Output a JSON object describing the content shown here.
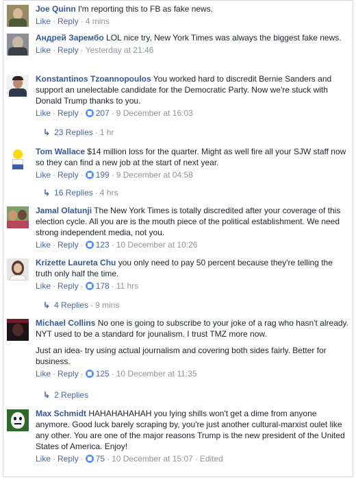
{
  "comments": [
    {
      "author": "Joe Quinn",
      "text": "I'm reporting this to FB as fake news.",
      "like": "Like",
      "reply": "Reply",
      "time": "4 mins"
    },
    {
      "author": "Андрей Зарембо",
      "text": "LOL nice try, New York Times was always the biggest fake news.",
      "like": "Like",
      "reply": "Reply",
      "time": "Yesterday at 21:46"
    },
    {
      "author": "Konstantinos Tzoannopoulos",
      "text": "You worked hard to discredit Bernie Sanders and support an unelectable candidate for the Democratic Party. Now we're stuck with Donald Trump thanks to you.",
      "like": "Like",
      "reply": "Reply",
      "likes": "207",
      "time": "9 December at 16:03",
      "replies": "23 Replies",
      "replies_time": "1 hr"
    },
    {
      "author": "Tom Wallace",
      "text": "$14 million loss for the quarter. Might as well fire all your SJW staff now so they can find a new job at the start of next year.",
      "like": "Like",
      "reply": "Reply",
      "likes": "199",
      "time": "9 December at 04:58",
      "replies": "16 Replies",
      "replies_time": "4 hrs"
    },
    {
      "author": "Jamal Olatunji",
      "text": "The New York Times is totally discredited after your coverage of this election cycle. All you are is the mouth piece of the political establishment. We need strong independent media, not you.",
      "like": "Like",
      "reply": "Reply",
      "likes": "123",
      "time": "10 December at 10:26"
    },
    {
      "author": "Krizette Laureta Chu",
      "text": "you only need to pay 50 percent because they're telling the truth only half the time.",
      "like": "Like",
      "reply": "Reply",
      "likes": "178",
      "time": "11 hrs",
      "replies": "4 Replies",
      "replies_time": "9 mins"
    },
    {
      "author": "Michael Collins",
      "text": "No one is going to subscribe to your joke of a rag who hasn't already. NYT used to be a standard for jounalism. I trust TMZ more now.",
      "text2": "Just an idea- try using actual journalism and covering both sides fairly. Better for business.",
      "like": "Like",
      "reply": "Reply",
      "likes": "125",
      "time": "10 December at 11:35",
      "replies": "2 Replies"
    },
    {
      "author": "Max Schmidt",
      "text": "HAHAHAHAHAH you lying shills won't get a dime from anyone anymore. Good luck barely scraping by, you're just another cultural-marxist oulet like any other. You are one of the major reasons Trump is the new president of the United States of America. Enjoy!",
      "like": "Like",
      "reply": "Reply",
      "likes": "75",
      "time": "10 December at 15:07",
      "edited": "Edited"
    }
  ],
  "separator": "·",
  "colors": {
    "link": "#365899",
    "muted": "#90949c",
    "like_blue": "#5890ff",
    "border": "#d7d9dd"
  }
}
